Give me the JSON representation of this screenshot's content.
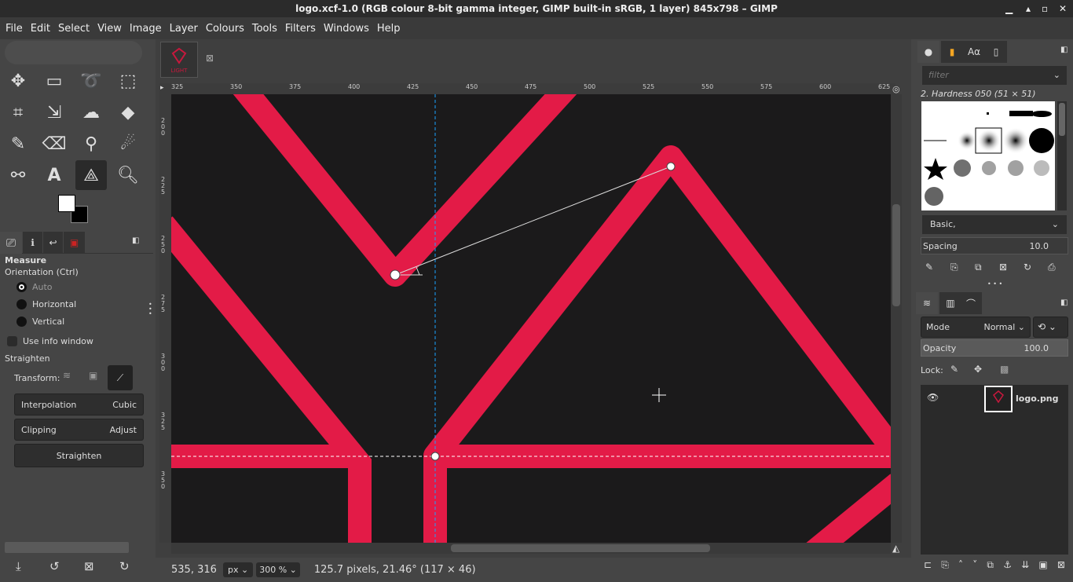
{
  "window": {
    "title": "logo.xcf-1.0 (RGB colour 8-bit gamma integer, GIMP built-in sRGB, 1 layer) 845x798 – GIMP"
  },
  "menu": [
    "File",
    "Edit",
    "Select",
    "View",
    "Image",
    "Layer",
    "Colours",
    "Tools",
    "Filters",
    "Windows",
    "Help"
  ],
  "tool_options": {
    "title": "Measure",
    "orientation_label": "Orientation  (Ctrl)",
    "radios": [
      "Auto",
      "Horizontal",
      "Vertical"
    ],
    "selected": "Auto",
    "use_info_window": "Use info window",
    "straighten_label": "Straighten",
    "transform_label": "Transform:",
    "interpolation_label": "Interpolation",
    "interpolation_value": "Cubic",
    "clipping_label": "Clipping",
    "clipping_value": "Adjust",
    "straighten_button": "Straighten"
  },
  "ruler": {
    "h_labels": [
      "325",
      "350",
      "375",
      "400",
      "425",
      "450",
      "475",
      "500",
      "525",
      "550",
      "575",
      "600",
      "625"
    ],
    "v_labels": [
      "200",
      "225",
      "250",
      "275",
      "300",
      "325",
      "350"
    ]
  },
  "status": {
    "coords": "535, 316",
    "unit": "px",
    "zoom": "300 %",
    "message": "125.7 pixels, 21.46° (117 × 46)"
  },
  "brushes": {
    "filter_placeholder": "filter",
    "current": "2. Hardness 050 (51 × 51)",
    "tag": "Basic,",
    "spacing_label": "Spacing",
    "spacing_value": "10.0"
  },
  "layers": {
    "mode_label": "Mode",
    "mode_value": "Normal",
    "opacity_label": "Opacity",
    "opacity_value": "100.0",
    "lock_label": "Lock:",
    "items": [
      {
        "name": "logo.png",
        "visible": true
      }
    ]
  },
  "thumb_text": "LIGHT",
  "colors": {
    "logo": "#e31b47",
    "canvas": "#1b1a1b",
    "guide": "#1aa3ff"
  }
}
